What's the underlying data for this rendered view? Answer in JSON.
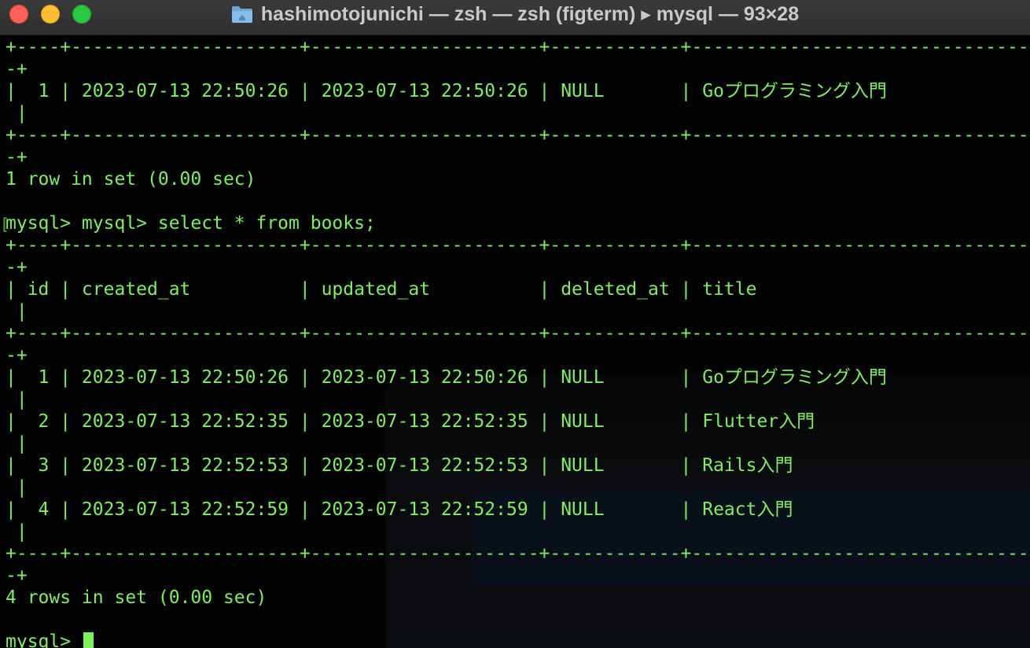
{
  "window": {
    "title": "hashimotojunichi — zsh — zsh (figterm) ▸ mysql — 93×28",
    "folder_icon": "folder-icon",
    "controls": [
      "close",
      "minimize",
      "zoom"
    ]
  },
  "terminal": {
    "lines": [
      "+----+---------------------+---------------------+------------+--------------------------------",
      "-+",
      "|  1 | 2023-07-13 22:50:26 | 2023-07-13 22:50:26 | NULL       | Goプログラミング入門",
      " |",
      "+----+---------------------+---------------------+------------+--------------------------------",
      "-+",
      "1 row in set (0.00 sec)",
      "",
      "mysql> mysql> select * from books;",
      "+----+---------------------+---------------------+------------+--------------------------------",
      "-+",
      "| id | created_at          | updated_at          | deleted_at | title",
      " |",
      "+----+---------------------+---------------------+------------+--------------------------------",
      "-+",
      "|  1 | 2023-07-13 22:50:26 | 2023-07-13 22:50:26 | NULL       | Goプログラミング入門",
      " |",
      "|  2 | 2023-07-13 22:52:35 | 2023-07-13 22:52:35 | NULL       | Flutter入門",
      " |",
      "|  3 | 2023-07-13 22:52:53 | 2023-07-13 22:52:53 | NULL       | Rails入門",
      " |",
      "|  4 | 2023-07-13 22:52:59 | 2023-07-13 22:52:59 | NULL       | React入門",
      " |",
      "+----+---------------------+---------------------+------------+--------------------------------",
      "-+",
      "4 rows in set (0.00 sec)",
      "",
      "mysql> "
    ],
    "text_color": "#7ef05a",
    "background_color": "#030303"
  }
}
